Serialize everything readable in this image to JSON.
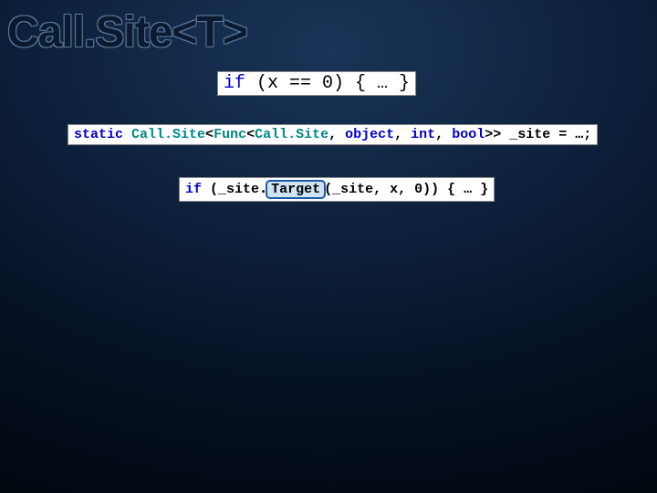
{
  "title": "Call.Site<T>",
  "code1": {
    "kw_if": "if",
    "rest": " (x == 0) { … }"
  },
  "code2": {
    "kw_static": "static",
    "sp1": " ",
    "type1": "Call.Site",
    "lt1": "<",
    "type2": "Func",
    "lt2": "<",
    "type3": "Call.Site",
    "comma1": ", ",
    "kw_object": "object",
    "comma2": ", ",
    "kw_int": "int",
    "comma3": ", ",
    "kw_bool": "bool",
    "gt": ">>",
    "rest": " _site = …;"
  },
  "code3": {
    "kw_if": "if",
    "pre": " (_site",
    "dot1": ".",
    "target": "Target",
    "open": "(",
    "post": "_site, x, 0)) { … }"
  }
}
